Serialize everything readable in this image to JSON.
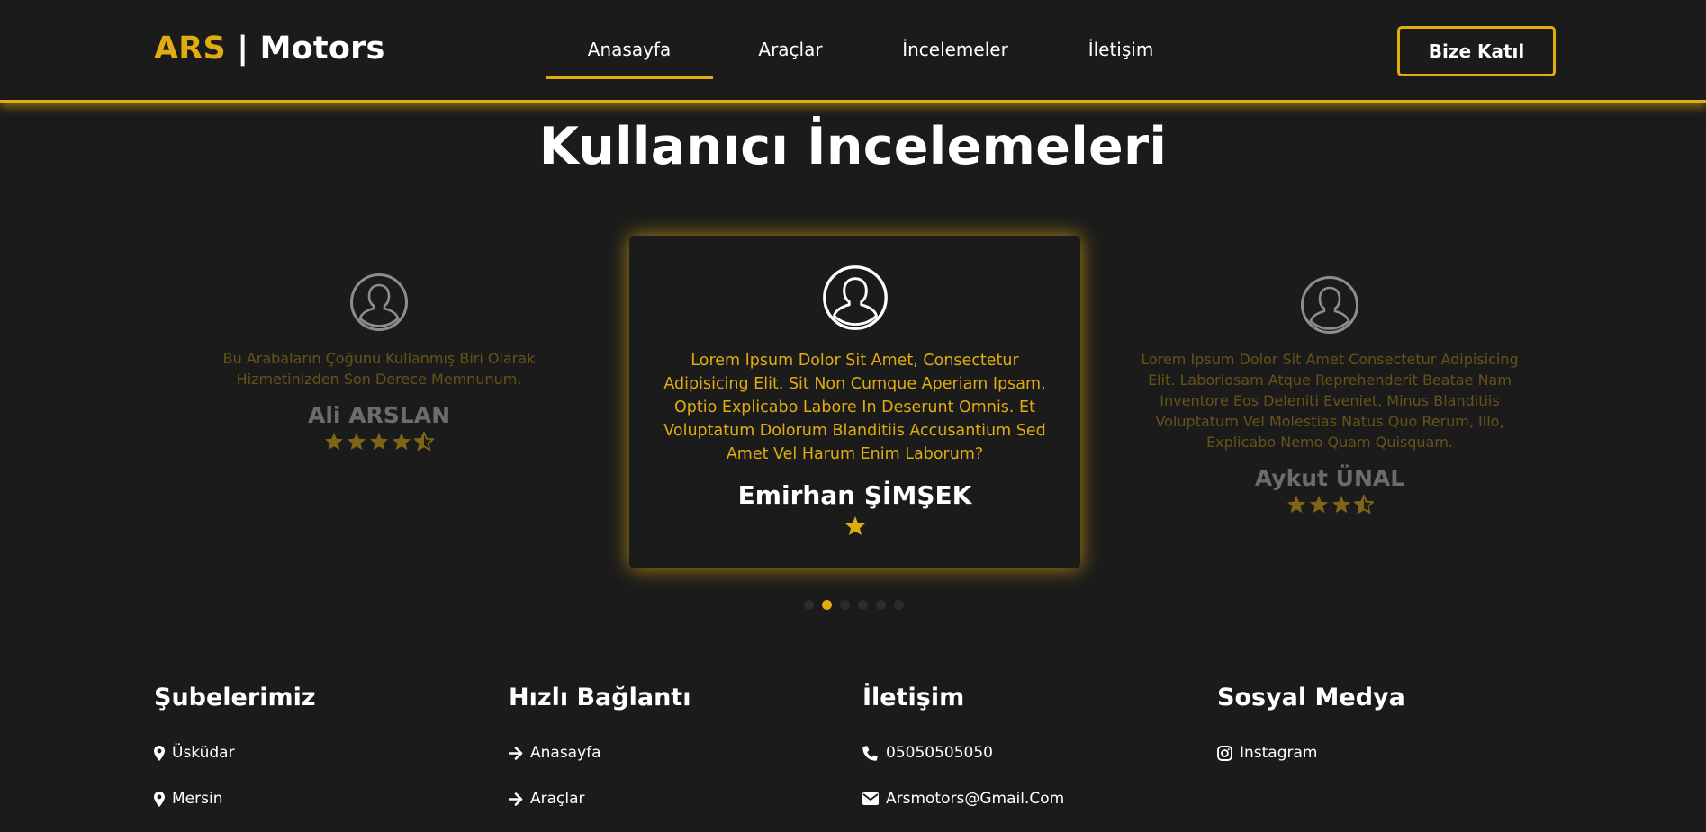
{
  "header": {
    "logo_brand": "ARS",
    "logo_rest": "| Motors",
    "nav": [
      {
        "label": "Anasayfa",
        "active": true
      },
      {
        "label": "Araçlar",
        "active": false
      },
      {
        "label": "İncelemeler",
        "active": false
      },
      {
        "label": "İletişim",
        "active": false
      }
    ],
    "join_button": "Bize Katıl"
  },
  "section": {
    "title": "Kullanıcı İncelemeleri"
  },
  "reviews": [
    {
      "text": "Bu Arabaların Çoğunu Kullanmış Biri Olarak Hizmetinizden Son Derece Memnunum.",
      "name": "Ali ARSLAN",
      "rating": 4.5
    },
    {
      "text": "Lorem Ipsum Dolor Sit Amet, Consectetur Adipisicing Elit. Sit Non Cumque Aperiam Ipsam, Optio Explicabo Labore In Deserunt Omnis. Et Voluptatum Dolorum Blanditiis Accusantium Sed Amet Vel Harum Enim Laborum?",
      "name": "Emirhan ŞİMŞEK",
      "rating": 1
    },
    {
      "text": "Lorem Ipsum Dolor Sit Amet Consectetur Adipisicing Elit. Laboriosam Atque Reprehenderit Beatae Nam Inventore Eos Deleniti Eveniet, Minus Blanditiis Voluptatum Vel Molestias Natus Quo Rerum, Illo, Explicabo Nemo Quam Quisquam.",
      "name": "Aykut ÜNAL",
      "rating": 3.5
    }
  ],
  "pagination": {
    "count": 6,
    "active_index": 1
  },
  "footer": {
    "branches": {
      "title": "Şubelerimiz",
      "items": [
        "Üsküdar",
        "Mersin"
      ]
    },
    "quick_links": {
      "title": "Hızlı Bağlantı",
      "items": [
        "Anasayfa",
        "Araçlar"
      ]
    },
    "contact": {
      "title": "İletişim",
      "phone": "05050505050",
      "email": "Arsmotors@Gmail.Com"
    },
    "social": {
      "title": "Sosyal Medya",
      "items": [
        "Instagram"
      ]
    }
  },
  "colors": {
    "accent": "#e0ac10",
    "background": "#1b1b1b"
  },
  "icons": {
    "avatar": "user-circle-icon",
    "star": "star-icon",
    "star_half": "star-half-icon",
    "location": "map-marker-icon",
    "arrow": "arrow-right-icon",
    "phone": "phone-icon",
    "email": "envelope-icon",
    "instagram": "instagram-icon"
  }
}
